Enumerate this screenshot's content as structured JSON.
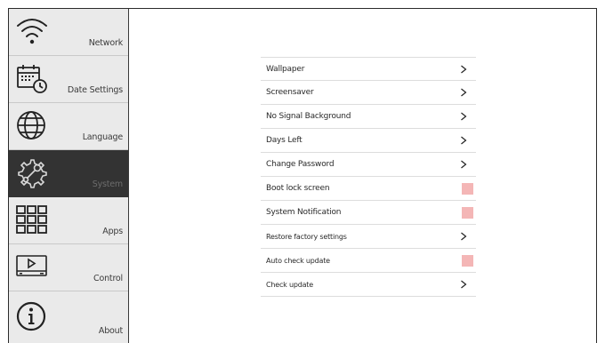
{
  "sidebar": {
    "items": [
      {
        "label": "Network",
        "icon": "wifi-icon",
        "active": false
      },
      {
        "label": "Date Settings",
        "icon": "calendar-clock-icon",
        "active": false
      },
      {
        "label": "Language",
        "icon": "globe-icon",
        "active": false
      },
      {
        "label": "System",
        "icon": "gear-wrench-icon",
        "active": true
      },
      {
        "label": "Apps",
        "icon": "apps-grid-icon",
        "active": false
      },
      {
        "label": "Control",
        "icon": "media-control-icon",
        "active": false
      },
      {
        "label": "About",
        "icon": "info-icon",
        "active": false
      }
    ]
  },
  "settings": [
    {
      "label": "Wallpaper",
      "control": "chevron"
    },
    {
      "label": "Screensaver",
      "control": "chevron"
    },
    {
      "label": "No Signal Background",
      "control": "chevron"
    },
    {
      "label": "Days Left",
      "control": "chevron"
    },
    {
      "label": "Change Password",
      "control": "chevron"
    },
    {
      "label": "Boot lock screen",
      "control": "toggle"
    },
    {
      "label": "System Notification",
      "control": "toggle"
    },
    {
      "label": "Restore factory settings",
      "control": "chevron"
    },
    {
      "label": "Auto check update",
      "control": "toggle"
    },
    {
      "label": "Check update",
      "control": "chevron"
    }
  ],
  "colors": {
    "sidebar_bg": "#eaeaea",
    "active_bg": "#333333",
    "toggle_off": "#f4b6b6",
    "text": "#2a2a2a"
  }
}
